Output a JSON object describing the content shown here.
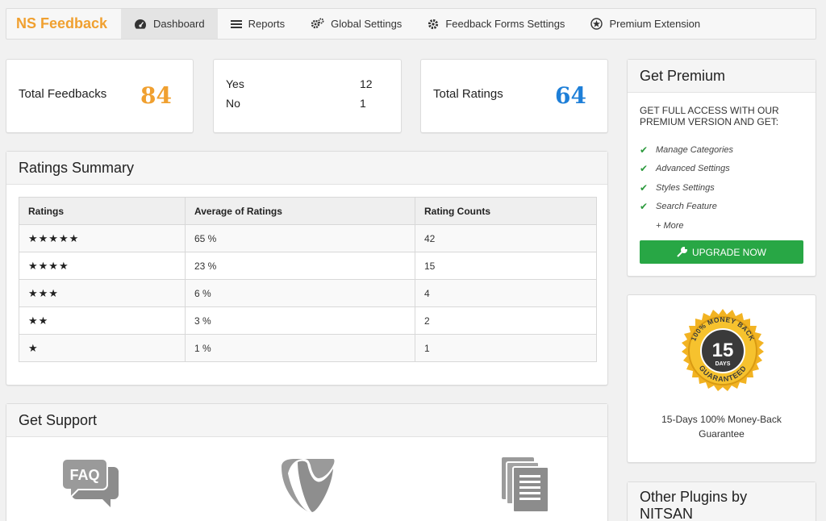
{
  "nav": {
    "brand": "NS Feedback",
    "items": [
      {
        "label": "Dashboard",
        "icon": "dashboard-icon",
        "active": true
      },
      {
        "label": "Reports",
        "icon": "list-icon"
      },
      {
        "label": "Global Settings",
        "icon": "cogs-icon"
      },
      {
        "label": "Feedback Forms Settings",
        "icon": "gear-icon"
      },
      {
        "label": "Premium Extension",
        "icon": "star-badge-icon"
      }
    ]
  },
  "stats": {
    "total_feedbacks_label": "Total Feedbacks",
    "total_feedbacks_value": "84",
    "yes_label": "Yes",
    "yes_value": "12",
    "no_label": "No",
    "no_value": "1",
    "total_ratings_label": "Total Ratings",
    "total_ratings_value": "64"
  },
  "ratings_summary": {
    "title": "Ratings Summary",
    "columns": [
      "Ratings",
      "Average of Ratings",
      "Rating Counts"
    ],
    "rows": [
      {
        "stars": "★★★★★",
        "average": "65 %",
        "count": "42"
      },
      {
        "stars": "★★★★",
        "average": "23 %",
        "count": "15"
      },
      {
        "stars": "★★★",
        "average": "6 %",
        "count": "4"
      },
      {
        "stars": "★★",
        "average": "3 %",
        "count": "2"
      },
      {
        "stars": "★",
        "average": "1 %",
        "count": "1"
      }
    ]
  },
  "support": {
    "title": "Get Support",
    "faq_text": "FAQ"
  },
  "premium": {
    "title": "Get Premium",
    "lead": "GET FULL ACCESS WITH OUR PREMIUM VERSION AND GET:",
    "features": [
      "Manage Categories",
      "Advanced Settings",
      "Styles Settings",
      "Search Feature"
    ],
    "more": "+ More",
    "button": "UPGRADE NOW"
  },
  "money_back": {
    "badge_top": "100% MONEY BACK",
    "badge_bottom": "GUARANTEED",
    "days_number": "15",
    "days_label": "DAYS",
    "caption_line1": "15-Days 100% Money-Back",
    "caption_line2": "Guarantee"
  },
  "other_plugins": {
    "title_line1": "Other Plugins by",
    "title_line2": "NITSAN"
  },
  "colors": {
    "brand": "#f0a030",
    "orange_stat": "#f0a030",
    "blue_stat": "#1e7fd8",
    "upgrade_green": "#28a745",
    "badge_gold": "#f2b322",
    "badge_dark": "#3a3a3a"
  }
}
